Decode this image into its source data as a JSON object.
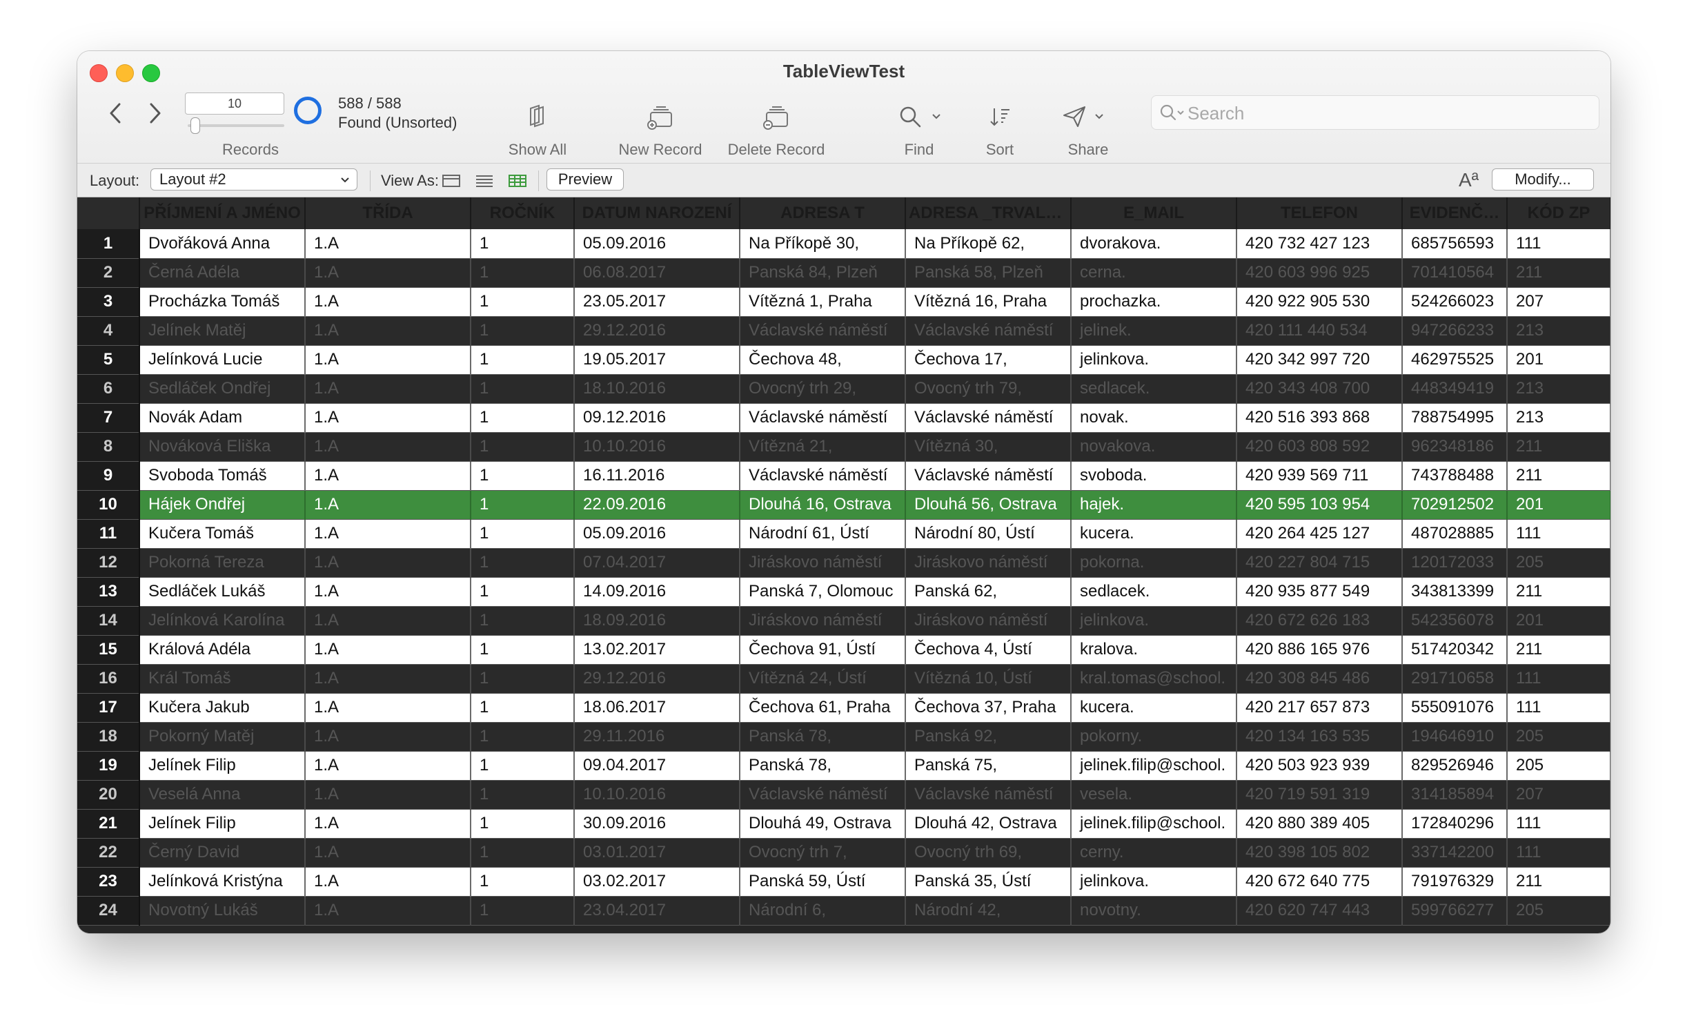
{
  "window": {
    "title": "TableViewTest"
  },
  "toolbar": {
    "record_number": "10",
    "found_count": "588 / 588",
    "found_status": "Found (Unsorted)",
    "labels": {
      "records": "Records",
      "show_all": "Show All",
      "new_record": "New Record",
      "delete_record": "Delete Record",
      "find": "Find",
      "sort": "Sort",
      "share": "Share"
    },
    "search_placeholder": "Search"
  },
  "layout_bar": {
    "layout_label": "Layout:",
    "layout_value": "Layout #2",
    "view_as_label": "View As:",
    "preview_label": "Preview",
    "font_icon_text": "Aª",
    "modify_label": "Modify..."
  },
  "colors": {
    "accent": "#1f6fe0",
    "selected_row": "#3e8e3e",
    "table_dark": "#2a2a2a"
  },
  "table": {
    "columns": [
      "PŘÍJMENÍ A JMÉNO",
      "TŘÍDA",
      "ROČNÍK",
      "DATUM NAROZENÍ",
      "ADRESA T",
      "ADRESA _TRVALÉ…",
      "E_MAIL",
      "TELEFON",
      "EVIDENČ…",
      "KÓD ZP"
    ],
    "selected_row": 10,
    "rows": [
      {
        "n": "1",
        "name": "Dvořáková Anna",
        "trida": "1.A",
        "rocnik": "1",
        "datum": "05.09.2016",
        "adresa_t": "Na Příkopě 30,",
        "adresa_trv": "Na Příkopě 62,",
        "email": "dvorakova.",
        "telefon": "420 732 427 123",
        "evid": "685756593",
        "kod": "111"
      },
      {
        "n": "2",
        "name": "Černá Adéla",
        "trida": "1.A",
        "rocnik": "1",
        "datum": "06.08.2017",
        "adresa_t": "Panská 84, Plzeň",
        "adresa_trv": "Panská 58, Plzeň",
        "email": "cerna.",
        "telefon": "420 603 996 925",
        "evid": "701410564",
        "kod": "211"
      },
      {
        "n": "3",
        "name": "Procházka Tomáš",
        "trida": "1.A",
        "rocnik": "1",
        "datum": "23.05.2017",
        "adresa_t": "Vítězná 1, Praha",
        "adresa_trv": "Vítězná 16, Praha",
        "email": "prochazka.",
        "telefon": "420 922 905 530",
        "evid": "524266023",
        "kod": "207"
      },
      {
        "n": "4",
        "name": "Jelínek Matěj",
        "trida": "1.A",
        "rocnik": "1",
        "datum": "29.12.2016",
        "adresa_t": "Václavské náměstí",
        "adresa_trv": "Václavské náměstí",
        "email": "jelinek.",
        "telefon": "420 111 440 534",
        "evid": "947266233",
        "kod": "213"
      },
      {
        "n": "5",
        "name": "Jelínková Lucie",
        "trida": "1.A",
        "rocnik": "1",
        "datum": "19.05.2017",
        "adresa_t": "Čechova 48,",
        "adresa_trv": "Čechova 17,",
        "email": "jelinkova.",
        "telefon": "420 342 997 720",
        "evid": "462975525",
        "kod": "201"
      },
      {
        "n": "6",
        "name": "Sedláček Ondřej",
        "trida": "1.A",
        "rocnik": "1",
        "datum": "18.10.2016",
        "adresa_t": "Ovocný trh 29,",
        "adresa_trv": "Ovocný trh 79,",
        "email": "sedlacek.",
        "telefon": "420 343 408 700",
        "evid": "448349419",
        "kod": "213"
      },
      {
        "n": "7",
        "name": "Novák Adam",
        "trida": "1.A",
        "rocnik": "1",
        "datum": "09.12.2016",
        "adresa_t": "Václavské náměstí",
        "adresa_trv": "Václavské náměstí",
        "email": "novak.",
        "telefon": "420 516 393 868",
        "evid": "788754995",
        "kod": "213"
      },
      {
        "n": "8",
        "name": "Nováková Eliška",
        "trida": "1.A",
        "rocnik": "1",
        "datum": "10.10.2016",
        "adresa_t": "Vítězná 21,",
        "adresa_trv": "Vítězná 30,",
        "email": "novakova.",
        "telefon": "420 603 808 592",
        "evid": "962348186",
        "kod": "211"
      },
      {
        "n": "9",
        "name": "Svoboda Tomáš",
        "trida": "1.A",
        "rocnik": "1",
        "datum": "16.11.2016",
        "adresa_t": "Václavské náměstí",
        "adresa_trv": "Václavské náměstí",
        "email": "svoboda.",
        "telefon": "420 939 569 711",
        "evid": "743788488",
        "kod": "211"
      },
      {
        "n": "10",
        "name": "Hájek Ondřej",
        "trida": "1.A",
        "rocnik": "1",
        "datum": "22.09.2016",
        "adresa_t": "Dlouhá 16, Ostrava",
        "adresa_trv": "Dlouhá 56, Ostrava",
        "email": "hajek.",
        "telefon": "420 595 103 954",
        "evid": "702912502",
        "kod": "201"
      },
      {
        "n": "11",
        "name": "Kučera Tomáš",
        "trida": "1.A",
        "rocnik": "1",
        "datum": "05.09.2016",
        "adresa_t": "Národní 61, Ústí",
        "adresa_trv": "Národní 80, Ústí",
        "email": "kucera.",
        "telefon": "420 264 425 127",
        "evid": "487028885",
        "kod": "111"
      },
      {
        "n": "12",
        "name": "Pokorná Tereza",
        "trida": "1.A",
        "rocnik": "1",
        "datum": "07.04.2017",
        "adresa_t": "Jiráskovo náměstí",
        "adresa_trv": "Jiráskovo náměstí",
        "email": "pokorna.",
        "telefon": "420 227 804 715",
        "evid": "120172033",
        "kod": "205"
      },
      {
        "n": "13",
        "name": "Sedláček Lukáš",
        "trida": "1.A",
        "rocnik": "1",
        "datum": "14.09.2016",
        "adresa_t": "Panská 7, Olomouc",
        "adresa_trv": "Panská 62,",
        "email": "sedlacek.",
        "telefon": "420 935 877 549",
        "evid": "343813399",
        "kod": "211"
      },
      {
        "n": "14",
        "name": "Jelínková Karolína",
        "trida": "1.A",
        "rocnik": "1",
        "datum": "18.09.2016",
        "adresa_t": "Jiráskovo náměstí",
        "adresa_trv": "Jiráskovo náměstí",
        "email": "jelinkova.",
        "telefon": "420 672 626 183",
        "evid": "542356078",
        "kod": "201"
      },
      {
        "n": "15",
        "name": "Králová Adéla",
        "trida": "1.A",
        "rocnik": "1",
        "datum": "13.02.2017",
        "adresa_t": "Čechova 91, Ústí",
        "adresa_trv": "Čechova 4, Ústí",
        "email": "kralova.",
        "telefon": "420 886 165 976",
        "evid": "517420342",
        "kod": "211"
      },
      {
        "n": "16",
        "name": "Král Tomáš",
        "trida": "1.A",
        "rocnik": "1",
        "datum": "29.12.2016",
        "adresa_t": "Vítězná 24, Ústí",
        "adresa_trv": "Vítězná 10, Ústí",
        "email": "kral.tomas@school.",
        "telefon": "420 308 845 486",
        "evid": "291710658",
        "kod": "111"
      },
      {
        "n": "17",
        "name": "Kučera Jakub",
        "trida": "1.A",
        "rocnik": "1",
        "datum": "18.06.2017",
        "adresa_t": "Čechova 61, Praha",
        "adresa_trv": "Čechova 37, Praha",
        "email": "kucera.",
        "telefon": "420 217 657 873",
        "evid": "555091076",
        "kod": "111"
      },
      {
        "n": "18",
        "name": "Pokorný Matěj",
        "trida": "1.A",
        "rocnik": "1",
        "datum": "29.11.2016",
        "adresa_t": "Panská 78,",
        "adresa_trv": "Panská 92,",
        "email": "pokorny.",
        "telefon": "420 134 163 535",
        "evid": "194646910",
        "kod": "205"
      },
      {
        "n": "19",
        "name": "Jelínek Filip",
        "trida": "1.A",
        "rocnik": "1",
        "datum": "09.04.2017",
        "adresa_t": "Panská 78,",
        "adresa_trv": "Panská 75,",
        "email": "jelinek.filip@school.",
        "telefon": "420 503 923 939",
        "evid": "829526946",
        "kod": "205"
      },
      {
        "n": "20",
        "name": "Veselá Anna",
        "trida": "1.A",
        "rocnik": "1",
        "datum": "10.10.2016",
        "adresa_t": "Václavské náměstí",
        "adresa_trv": "Václavské náměstí",
        "email": "vesela.",
        "telefon": "420 719 591 319",
        "evid": "314185894",
        "kod": "207"
      },
      {
        "n": "21",
        "name": "Jelínek Filip",
        "trida": "1.A",
        "rocnik": "1",
        "datum": "30.09.2016",
        "adresa_t": "Dlouhá 49, Ostrava",
        "adresa_trv": "Dlouhá 42, Ostrava",
        "email": "jelinek.filip@school.",
        "telefon": "420 880 389 405",
        "evid": "172840296",
        "kod": "111"
      },
      {
        "n": "22",
        "name": "Černý David",
        "trida": "1.A",
        "rocnik": "1",
        "datum": "03.01.2017",
        "adresa_t": "Ovocný trh 7,",
        "adresa_trv": "Ovocný trh 69,",
        "email": "cerny.",
        "telefon": "420 398 105 802",
        "evid": "337142200",
        "kod": "111"
      },
      {
        "n": "23",
        "name": "Jelínková Kristýna",
        "trida": "1.A",
        "rocnik": "1",
        "datum": "03.02.2017",
        "adresa_t": "Panská 59, Ústí",
        "adresa_trv": "Panská 35, Ústí",
        "email": "jelinkova.",
        "telefon": "420 672 640 775",
        "evid": "791976329",
        "kod": "211"
      },
      {
        "n": "24",
        "name": "Novotný Lukáš",
        "trida": "1.A",
        "rocnik": "1",
        "datum": "23.04.2017",
        "adresa_t": "Národní 6,",
        "adresa_trv": "Národní 42,",
        "email": "novotny.",
        "telefon": "420 620 747 443",
        "evid": "599766277",
        "kod": "205"
      }
    ]
  }
}
